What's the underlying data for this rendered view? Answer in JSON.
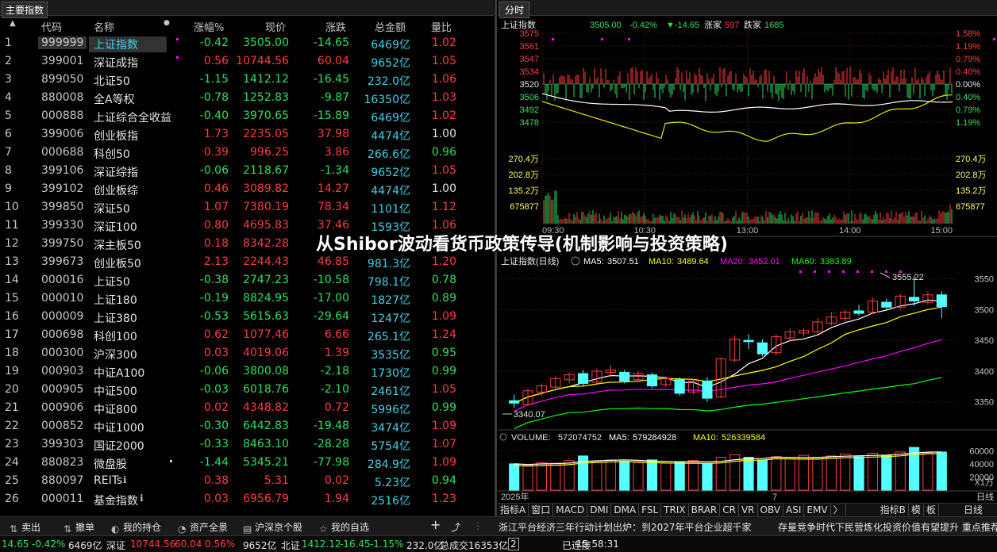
{
  "left_panel": {
    "tab_label": "主要指数",
    "columns": [
      "代码",
      "名称",
      "涨幅%",
      "现价",
      "涨跌",
      "总金额",
      "量比"
    ],
    "rows": [
      {
        "idx": "1",
        "code": "999999",
        "name": "上证指数",
        "pct": "-0.42",
        "price": "3505.00",
        "chg": "-14.65",
        "amt": "6469亿",
        "ratio": "1.02",
        "dir": "down",
        "rdir": "up"
      },
      {
        "idx": "2",
        "code": "399001",
        "name": "深证成指",
        "pct": "0.56",
        "price": "10744.56",
        "chg": "60.04",
        "amt": "9652亿",
        "ratio": "1.05",
        "dir": "up",
        "rdir": "up"
      },
      {
        "idx": "3",
        "code": "899050",
        "name": "北证50",
        "pct": "-1.15",
        "price": "1412.12",
        "chg": "-16.45",
        "amt": "232.0亿",
        "ratio": "1.06",
        "dir": "down",
        "rdir": "up"
      },
      {
        "idx": "4",
        "code": "880008",
        "name": "全A等权",
        "pct": "-0.78",
        "price": "1252.83",
        "chg": "-9.87",
        "amt": "16350亿",
        "ratio": "1.03",
        "dir": "down",
        "rdir": "up"
      },
      {
        "idx": "5",
        "code": "000888",
        "name": "上证综合全收益",
        "pct": "-0.40",
        "price": "3970.65",
        "chg": "-15.89",
        "amt": "6469亿",
        "ratio": "1.02",
        "dir": "down",
        "rdir": "up"
      },
      {
        "idx": "6",
        "code": "399006",
        "name": "创业板指",
        "pct": "1.73",
        "price": "2235.05",
        "chg": "37.98",
        "amt": "4474亿",
        "ratio": "1.00",
        "dir": "up",
        "rdir": "flat"
      },
      {
        "idx": "7",
        "code": "000688",
        "name": "科创50",
        "pct": "0.39",
        "price": "996.25",
        "chg": "3.86",
        "amt": "266.6亿",
        "ratio": "0.96",
        "dir": "up",
        "rdir": "down"
      },
      {
        "idx": "8",
        "code": "399106",
        "name": "深证综指",
        "pct": "-0.06",
        "price": "2118.67",
        "chg": "-1.34",
        "amt": "9652亿",
        "ratio": "1.05",
        "dir": "down",
        "rdir": "up"
      },
      {
        "idx": "9",
        "code": "399102",
        "name": "创业板综",
        "pct": "0.46",
        "price": "3089.82",
        "chg": "14.27",
        "amt": "4474亿",
        "ratio": "1.00",
        "dir": "up",
        "rdir": "flat"
      },
      {
        "idx": "10",
        "code": "399850",
        "name": "深证50",
        "pct": "1.07",
        "price": "7380.19",
        "chg": "78.34",
        "amt": "1101亿",
        "ratio": "1.12",
        "dir": "up",
        "rdir": "up"
      },
      {
        "idx": "11",
        "code": "399330",
        "name": "深证100",
        "pct": "0.80",
        "price": "4695.83",
        "chg": "37.46",
        "amt": "1593亿",
        "ratio": "1.06",
        "dir": "up",
        "rdir": "up"
      },
      {
        "idx": "12",
        "code": "399750",
        "name": "深主板50",
        "pct": "0.18",
        "price": "8342.28",
        "chg": "",
        "amt": "",
        "ratio": "",
        "dir": "up",
        "rdir": "up"
      },
      {
        "idx": "13",
        "code": "399673",
        "name": "创业板50",
        "pct": "2.13",
        "price": "2244.43",
        "chg": "46.85",
        "amt": "981.3亿",
        "ratio": "1.20",
        "dir": "up",
        "rdir": "up"
      },
      {
        "idx": "14",
        "code": "000016",
        "name": "上证50",
        "pct": "-0.38",
        "price": "2747.23",
        "chg": "-10.58",
        "amt": "798.1亿",
        "ratio": "0.78",
        "dir": "down",
        "rdir": "down"
      },
      {
        "idx": "15",
        "code": "000010",
        "name": "上证180",
        "pct": "-0.19",
        "price": "8824.95",
        "chg": "-17.00",
        "amt": "1827亿",
        "ratio": "0.89",
        "dir": "down",
        "rdir": "down"
      },
      {
        "idx": "16",
        "code": "000009",
        "name": "上证380",
        "pct": "-0.53",
        "price": "5615.63",
        "chg": "-29.64",
        "amt": "1247亿",
        "ratio": "1.09",
        "dir": "down",
        "rdir": "up"
      },
      {
        "idx": "17",
        "code": "000698",
        "name": "科创100",
        "pct": "0.62",
        "price": "1077.46",
        "chg": "6.66",
        "amt": "265.1亿",
        "ratio": "1.24",
        "dir": "up",
        "rdir": "up"
      },
      {
        "idx": "18",
        "code": "000300",
        "name": "沪深300",
        "pct": "0.03",
        "price": "4019.06",
        "chg": "1.39",
        "amt": "3535亿",
        "ratio": "0.95",
        "dir": "up",
        "rdir": "down"
      },
      {
        "idx": "19",
        "code": "000903",
        "name": "中证A100",
        "pct": "-0.06",
        "price": "3800.08",
        "chg": "-2.18",
        "amt": "1730亿",
        "ratio": "0.99",
        "dir": "down",
        "rdir": "down"
      },
      {
        "idx": "20",
        "code": "000905",
        "name": "中证500",
        "pct": "-0.03",
        "price": "6018.76",
        "chg": "-2.10",
        "amt": "2461亿",
        "ratio": "1.05",
        "dir": "down",
        "rdir": "up"
      },
      {
        "idx": "21",
        "code": "000906",
        "name": "中证800",
        "pct": "0.02",
        "price": "4348.82",
        "chg": "0.72",
        "amt": "5996亿",
        "ratio": "0.99",
        "dir": "up",
        "rdir": "down"
      },
      {
        "idx": "22",
        "code": "000852",
        "name": "中证1000",
        "pct": "-0.30",
        "price": "6442.83",
        "chg": "-19.48",
        "amt": "3474亿",
        "ratio": "1.09",
        "dir": "down",
        "rdir": "up"
      },
      {
        "idx": "23",
        "code": "399303",
        "name": "国证2000",
        "pct": "-0.33",
        "price": "8463.10",
        "chg": "-28.28",
        "amt": "5754亿",
        "ratio": "1.07",
        "dir": "down",
        "rdir": "up"
      },
      {
        "idx": "24",
        "code": "880823",
        "name": "微盘股",
        "pct": "-1.44",
        "price": "5345.21",
        "chg": "-77.98",
        "amt": "284.9亿",
        "ratio": "1.09",
        "dir": "down",
        "rdir": "up"
      },
      {
        "idx": "25",
        "code": "880097",
        "name": "REITs",
        "pct": "0.38",
        "price": "5.31",
        "chg": "0.02",
        "amt": "5.23亿",
        "ratio": "0.94",
        "dir": "up",
        "rdir": "down"
      },
      {
        "idx": "26",
        "code": "000011",
        "name": "基金指数",
        "pct": "0.03",
        "price": "6956.79",
        "chg": "1.94",
        "amt": "2516亿",
        "ratio": "1.23",
        "dir": "up",
        "rdir": "up"
      }
    ]
  },
  "banner": "从Shibor波动看货币政策传导(机制影响与投资策略)",
  "intraday": {
    "tab_label": "分时",
    "header": {
      "name": "上证指数",
      "price": "3505.00",
      "pct": "-0.42%",
      "chg": "▼-14.65",
      "up_label": "涨家",
      "up_count": "597",
      "down_label": "跌家",
      "down_count": "1685"
    },
    "price_ticks": [
      "3575",
      "3561",
      "3547",
      "3534",
      "3520",
      "3506",
      "3492",
      "3478"
    ],
    "pct_ticks": [
      "1.58%",
      "1.19%",
      "0.79%",
      "0.40%",
      "0.00%",
      "0.40%",
      "0.79%",
      "1.19%"
    ],
    "vol_ticks": [
      "270.4万",
      "202.8万",
      "135.2万",
      "675877"
    ],
    "time_ticks": [
      "09:30",
      "10:30",
      "13:00",
      "14:00",
      "15:00"
    ]
  },
  "kline": {
    "header": {
      "name": "上证指数(日线)",
      "ma5_label": "MA5:",
      "ma5": "3507.51",
      "ma10_label": "MA10:",
      "ma10": "3489.64",
      "ma20_label": "MA20:",
      "ma20": "3452.01",
      "ma60_label": "MA60:",
      "ma60": "3383.89"
    },
    "price_ticks": [
      "3550",
      "3500",
      "3450",
      "3400",
      "3350"
    ],
    "high_label": "3555.22",
    "low_label": "3340.07",
    "volume": {
      "label": "VOLUME:",
      "value": "572074752",
      "ma5_label": "MA5:",
      "ma5": "579284928",
      "ma10_label": "MA10:",
      "ma10": "526339584",
      "ticks": [
        "60000",
        "40000",
        "20000"
      ],
      "unit": "X1万"
    },
    "date_labels": [
      "2025年",
      "7",
      "日线"
    ],
    "colors": {
      "ma5": "#ffffff",
      "ma10": "#ffff00",
      "ma20": "#ff00ff",
      "ma60": "#00ff00",
      "up": "#ff3c3c",
      "down": "#54ffff"
    },
    "chart_data": {
      "type": "candlestick",
      "title": "上证指数(日线)",
      "candles": [
        {
          "o": 3352,
          "h": 3362,
          "l": 3340,
          "c": 3348
        },
        {
          "o": 3346,
          "h": 3372,
          "l": 3344,
          "c": 3368
        },
        {
          "o": 3366,
          "h": 3380,
          "l": 3360,
          "c": 3376
        },
        {
          "o": 3374,
          "h": 3392,
          "l": 3370,
          "c": 3388
        },
        {
          "o": 3386,
          "h": 3398,
          "l": 3380,
          "c": 3394
        },
        {
          "o": 3396,
          "h": 3402,
          "l": 3376,
          "c": 3380
        },
        {
          "o": 3382,
          "h": 3404,
          "l": 3380,
          "c": 3400
        },
        {
          "o": 3398,
          "h": 3410,
          "l": 3390,
          "c": 3402
        },
        {
          "o": 3398,
          "h": 3402,
          "l": 3380,
          "c": 3384
        },
        {
          "o": 3386,
          "h": 3400,
          "l": 3382,
          "c": 3396
        },
        {
          "o": 3394,
          "h": 3398,
          "l": 3372,
          "c": 3376
        },
        {
          "o": 3378,
          "h": 3392,
          "l": 3374,
          "c": 3388
        },
        {
          "o": 3386,
          "h": 3390,
          "l": 3360,
          "c": 3364
        },
        {
          "o": 3366,
          "h": 3388,
          "l": 3362,
          "c": 3384
        },
        {
          "o": 3384,
          "h": 3390,
          "l": 3350,
          "c": 3356
        },
        {
          "o": 3358,
          "h": 3422,
          "l": 3356,
          "c": 3420
        },
        {
          "o": 3418,
          "h": 3458,
          "l": 3414,
          "c": 3452
        },
        {
          "o": 3450,
          "h": 3460,
          "l": 3436,
          "c": 3448
        },
        {
          "o": 3446,
          "h": 3452,
          "l": 3424,
          "c": 3428
        },
        {
          "o": 3430,
          "h": 3460,
          "l": 3426,
          "c": 3456
        },
        {
          "o": 3454,
          "h": 3470,
          "l": 3448,
          "c": 3464
        },
        {
          "o": 3462,
          "h": 3470,
          "l": 3456,
          "c": 3466
        },
        {
          "o": 3464,
          "h": 3486,
          "l": 3460,
          "c": 3480
        },
        {
          "o": 3478,
          "h": 3496,
          "l": 3474,
          "c": 3488
        },
        {
          "o": 3486,
          "h": 3500,
          "l": 3480,
          "c": 3496
        },
        {
          "o": 3498,
          "h": 3508,
          "l": 3490,
          "c": 3494
        },
        {
          "o": 3496,
          "h": 3520,
          "l": 3494,
          "c": 3514
        },
        {
          "o": 3512,
          "h": 3518,
          "l": 3500,
          "c": 3504
        },
        {
          "o": 3504,
          "h": 3526,
          "l": 3500,
          "c": 3522
        },
        {
          "o": 3520,
          "h": 3555,
          "l": 3506,
          "c": 3514
        },
        {
          "o": 3512,
          "h": 3530,
          "l": 3508,
          "c": 3524
        },
        {
          "o": 3524,
          "h": 3530,
          "l": 3486,
          "c": 3505
        }
      ],
      "volumes": [
        4.0,
        3.8,
        4.2,
        4.1,
        4.5,
        5.2,
        4.3,
        4.6,
        4.4,
        4.2,
        4.6,
        4.1,
        4.3,
        4.5,
        4.0,
        5.0,
        5.4,
        5.0,
        4.6,
        5.1,
        4.8,
        5.3,
        5.0,
        5.2,
        5.5,
        5.1,
        5.6,
        5.3,
        5.8,
        6.5,
        5.7,
        5.8
      ]
    }
  },
  "bottom_toolbar": [
    "指标A",
    "窗口",
    "MACD",
    "DMI",
    "DMA",
    "FSL",
    "TRIX",
    "BRAR",
    "CR",
    "VR",
    "OBV",
    "ASI",
    "EMV",
    "〉",
    "指标B",
    "模",
    "板",
    "日线"
  ],
  "footer": {
    "buttons": [
      "卖出",
      "撤单",
      "我的持仓",
      "资产全景",
      "沪深京个股",
      "我的自选"
    ],
    "news1": "浙江平台经济三年行动计划出炉：到2027年平台企业超千家",
    "news2": "存量竞争时代下民营炼化投资价值有望提升 重点推荐",
    "ticker": [
      {
        "t": "14.65",
        "c": "green"
      },
      {
        "t": "-0.42%",
        "c": "green"
      },
      {
        "t": "6469亿",
        "c": "white"
      },
      {
        "t": "深证",
        "c": "white"
      },
      {
        "t": "10744.56",
        "c": "red"
      },
      {
        "t": "60.04",
        "c": "red"
      },
      {
        "t": "0.56%",
        "c": "red"
      },
      {
        "t": "9652亿",
        "c": "white"
      },
      {
        "t": "北证",
        "c": "white"
      },
      {
        "t": "1412.12",
        "c": "green"
      },
      {
        "t": "-16.45",
        "c": "green"
      },
      {
        "t": "-1.15%",
        "c": "green"
      },
      {
        "t": "232.0亿",
        "c": "white"
      },
      {
        "t": "总成交",
        "c": "white"
      },
      {
        "t": "16353亿",
        "c": "white"
      },
      {
        "t": "2",
        "c": "white"
      },
      {
        "t": "已连接",
        "c": "white"
      },
      {
        "t": "15:58:31",
        "c": "white"
      }
    ]
  }
}
